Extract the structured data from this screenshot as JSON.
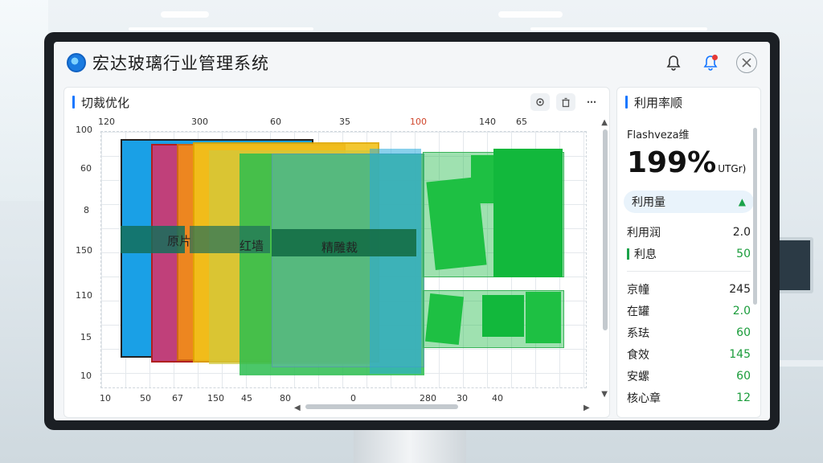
{
  "app": {
    "title": "宏达玻璃行业管理系统"
  },
  "icons": {
    "logo": "app-logo-icon",
    "bell": "bell-icon",
    "bell_alert": "bell-alert-icon",
    "close": "close-icon"
  },
  "left_panel": {
    "title": "切裁优化",
    "tools": [
      "settings-icon",
      "trash-icon",
      "more-icon"
    ]
  },
  "chart": {
    "x_top": [
      "120",
      "300",
      "60",
      "35",
      "100",
      "140",
      "65"
    ],
    "y_left": [
      "100",
      "60",
      "8",
      "150",
      "110",
      "15",
      "10"
    ],
    "x_bottom": [
      "10",
      "50",
      "67",
      "150",
      "45",
      "80",
      "0",
      "280",
      "30",
      "40"
    ],
    "bands": [
      "原片",
      "红墙",
      "精雕裁"
    ]
  },
  "right_panel": {
    "title": "利用率顺",
    "stat_label": "Flashveza维",
    "big_value": "199%",
    "big_unit": "UTGr)",
    "pill_label": "利用量",
    "rows": [
      {
        "label": "利用润",
        "value": "2.0"
      },
      {
        "label": "利息",
        "value": "50"
      }
    ],
    "list": [
      {
        "label": "京幢",
        "value": "245"
      },
      {
        "label": "在罐",
        "value": "2.0"
      },
      {
        "label": "系珐",
        "value": "60"
      },
      {
        "label": "食效",
        "value": "145"
      },
      {
        "label": "安螺",
        "value": "60"
      },
      {
        "label": "核心章",
        "value": "12"
      }
    ]
  },
  "colors": {
    "accent": "#1677ff",
    "green": "#1a9c3b",
    "sheet_blue": "#1aa0e6",
    "sheet_magenta": "#c0407a",
    "sheet_orange": "#f08a1c",
    "sheet_yellow": "#f2c21a",
    "sheet_green": "#2bbd4f"
  }
}
